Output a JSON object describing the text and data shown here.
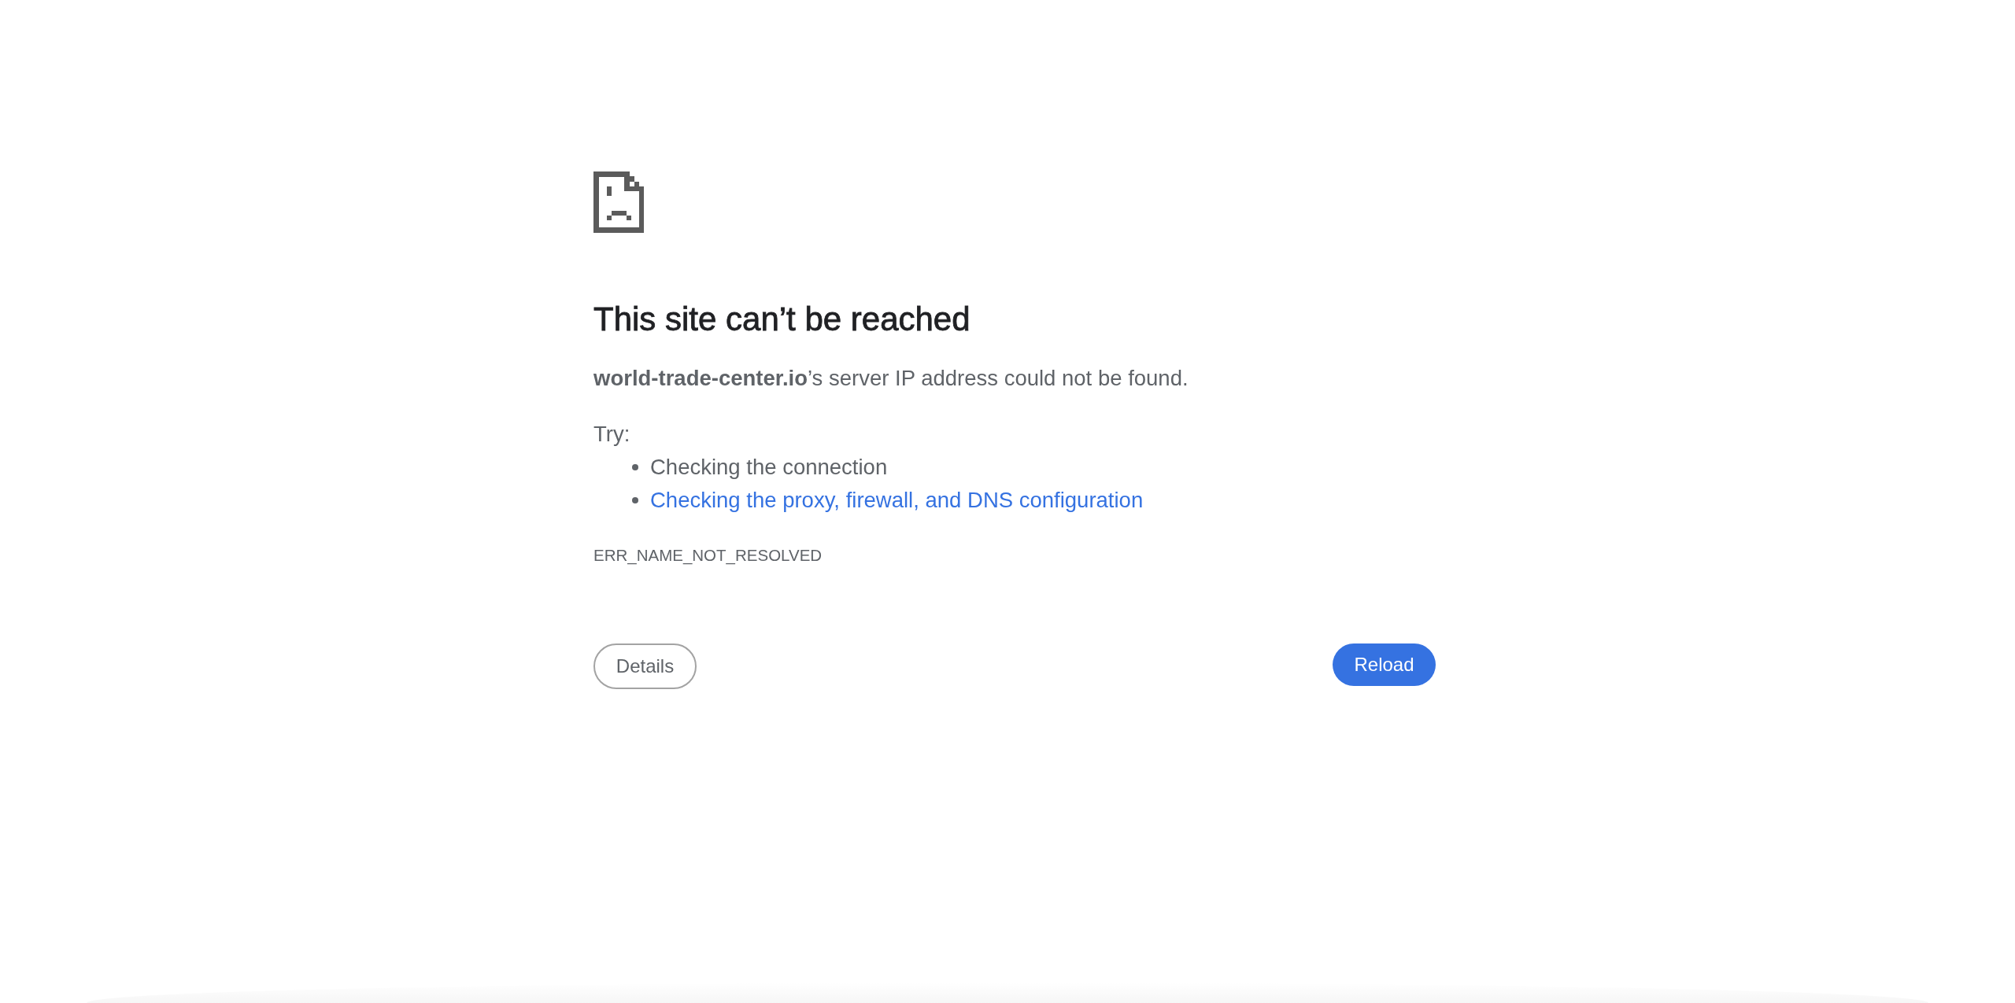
{
  "heading": "This site can’t be reached",
  "message": "**world-trade-center.io**’s server IP address could not be found.",
  "suggestions": {
    "label": "Try:",
    "items": [
      {
        "text": "Checking the connection",
        "kind": "text"
      },
      {
        "text": "Checking the proxy, firewall, and DNS configuration",
        "kind": "link"
      }
    ]
  },
  "error_code": "ERR_NAME_NOT_RESOLVED",
  "buttons": [
    {
      "label": "Details",
      "kind": "secondary"
    },
    {
      "label": "Reload",
      "kind": "primary"
    }
  ]
}
